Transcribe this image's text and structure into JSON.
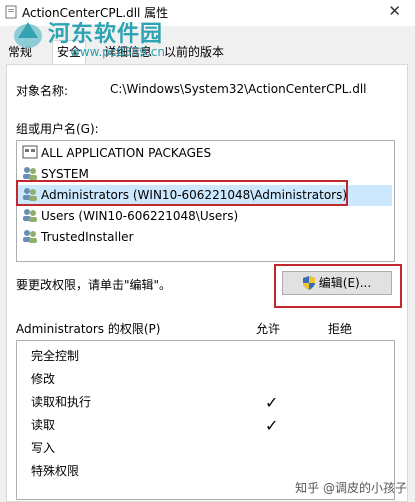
{
  "window": {
    "title": "ActionCenterCPL.dll 属性",
    "close_glyph": "✕"
  },
  "watermark": {
    "site_name": "河东软件园",
    "url": "www.pc0359.cn"
  },
  "tabs": [
    {
      "label": "常规",
      "active": false
    },
    {
      "label": "安全",
      "active": true
    },
    {
      "label": "详细信息",
      "active": false
    },
    {
      "label": "以前的版本",
      "active": false
    }
  ],
  "security": {
    "object_label": "对象名称:",
    "object_value": "C:\\Windows\\System32\\ActionCenterCPL.dll",
    "groups_label": "组或用户名(G):",
    "groups": [
      {
        "name": "ALL APPLICATION PACKAGES",
        "icon": "packages-icon",
        "selected": false
      },
      {
        "name": "SYSTEM",
        "icon": "users-icon",
        "selected": false
      },
      {
        "name": "Administrators (WIN10-606221048\\Administrators)",
        "icon": "users-icon",
        "selected": true
      },
      {
        "name": "Users (WIN10-606221048\\Users)",
        "icon": "users-icon",
        "selected": false
      },
      {
        "name": "TrustedInstaller",
        "icon": "users-icon",
        "selected": false
      }
    ],
    "change_hint": "要更改权限，请单击\"编辑\"。",
    "edit_button": "编辑(E)...",
    "permissions_label": "Administrators 的权限(P)",
    "allow_header": "允许",
    "deny_header": "拒绝",
    "permissions": [
      {
        "name": "完全控制",
        "allow": false,
        "deny": false
      },
      {
        "name": "修改",
        "allow": false,
        "deny": false
      },
      {
        "name": "读取和执行",
        "allow": true,
        "deny": false
      },
      {
        "name": "读取",
        "allow": true,
        "deny": false
      },
      {
        "name": "写入",
        "allow": false,
        "deny": false
      },
      {
        "name": "特殊权限",
        "allow": false,
        "deny": false
      }
    ],
    "check_glyph": "✓"
  },
  "footer_watermark": "知乎 @调皮的小孩子",
  "colors": {
    "highlight_red": "#c0282d",
    "selection_blue": "#cce8ff",
    "watermark_teal": "#22a0b0"
  }
}
